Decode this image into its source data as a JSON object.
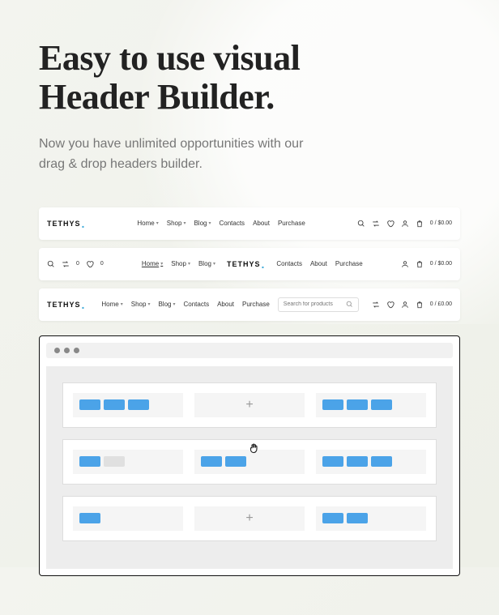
{
  "heading_line1": "Easy to use visual",
  "heading_line2": "Header Builder.",
  "subheading": "Now you have unlimited opportunities with our drag & drop headers builder.",
  "logo_text": "TETHYS",
  "nav": {
    "home": "Home",
    "shop": "Shop",
    "blog": "Blog",
    "contacts": "Contacts",
    "about": "About",
    "purchase": "Purchase"
  },
  "wishlist_count": "0",
  "compare_count": "0",
  "cart1": "0 / $0.00",
  "cart2": "0 / $0.00",
  "cart3": "0 / £0.00",
  "search_placeholder": "Search for products",
  "builder_plus": "+"
}
